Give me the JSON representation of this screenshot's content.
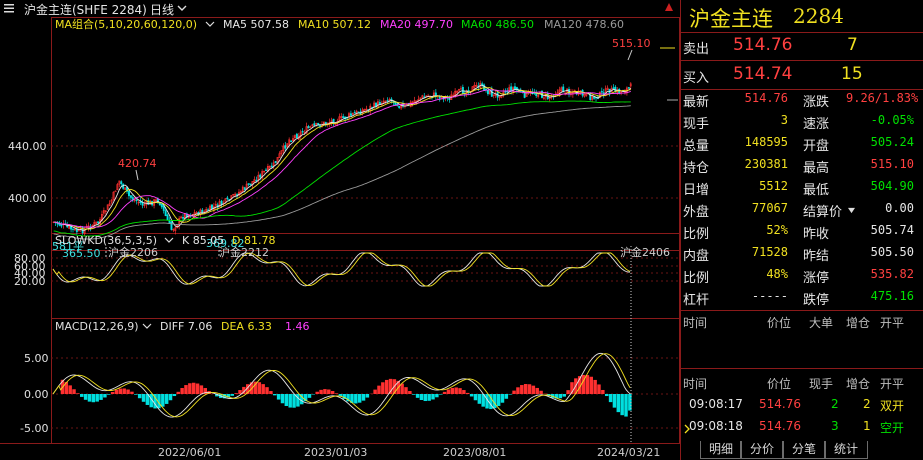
{
  "topbar": {
    "symbol_label": "沪金主连(SHFE 2284)",
    "period": "日线",
    "period_chevron": "chevron-down-icon",
    "scroll_up_icon": "triangle-up-icon"
  },
  "main_chart": {
    "indicator_title": "MA组合(5,10,20,60,120,0)",
    "ma": [
      {
        "label": "MA5 507.58",
        "color": "#e6e6e6"
      },
      {
        "label": "MA10 507.12",
        "color": "#f0e020"
      },
      {
        "label": "MA20 497.70",
        "color": "#ff40ff"
      },
      {
        "label": "MA60 486.50",
        "color": "#00e000"
      },
      {
        "label": "MA120 478.60",
        "color": "#9a9a9a"
      }
    ],
    "yticks": [
      "440.00",
      "400.00"
    ],
    "annotations": {
      "high_recent": "515.10",
      "peak_2022": "420.74",
      "low_2022": "369.82",
      "left_low": "365.50",
      "left_cut": "581平"
    },
    "contracts": [
      "沪金2206",
      "沪金2212",
      "沪金2406"
    ]
  },
  "kd_chart": {
    "title": "SLOWKD(36,5,3,5)",
    "k": "K 85.05",
    "d": "D 81.78",
    "yticks": [
      "80.00",
      "60.00",
      "40.00",
      "20.00"
    ]
  },
  "macd_chart": {
    "title": "MACD(12,26,9)",
    "diff": "DIFF 7.06",
    "dea": "DEA 6.33",
    "macd": "1.46",
    "yticks": [
      "5.00",
      "0.00",
      "-5.00"
    ]
  },
  "xaxis": [
    "2022/06/01",
    "2023/01/03",
    "2023/08/01",
    "2024/03/21"
  ],
  "quote": {
    "title": "沪金主连",
    "code": "2284",
    "sell_label": "卖出",
    "sell_price": "514.76",
    "sell_vol": "7",
    "buy_label": "买入",
    "buy_price": "514.74",
    "buy_vol": "15",
    "rows": [
      {
        "l1": "最新",
        "v1": "514.76",
        "c1": "red",
        "l2": "涨跌",
        "v2": "9.26/1.83%",
        "c2": "red"
      },
      {
        "l1": "现手",
        "v1": "3",
        "c1": "yel",
        "l2": "速涨",
        "v2": "-0.05%",
        "c2": "grn"
      },
      {
        "l1": "总量",
        "v1": "148595",
        "c1": "yel",
        "l2": "开盘",
        "v2": "505.24",
        "c2": "grn"
      },
      {
        "l1": "持仓",
        "v1": "230381",
        "c1": "yel",
        "l2": "最高",
        "v2": "515.10",
        "c2": "red"
      },
      {
        "l1": "日增",
        "v1": "5512",
        "c1": "yel",
        "l2": "最低",
        "v2": "504.90",
        "c2": "grn"
      },
      {
        "l1": "外盘",
        "v1": "77067",
        "c1": "yel",
        "l2": "结算价",
        "v2": "0.00",
        "c2": "wht"
      },
      {
        "l1": "比例",
        "v1": "52%",
        "c1": "yel",
        "l2": "昨收",
        "v2": "505.74",
        "c2": "wht"
      },
      {
        "l1": "内盘",
        "v1": "71528",
        "c1": "yel",
        "l2": "昨结",
        "v2": "505.50",
        "c2": "wht"
      },
      {
        "l1": "比例",
        "v1": "48%",
        "c1": "yel",
        "l2": "涨停",
        "v2": "535.82",
        "c2": "red"
      },
      {
        "l1": "杠杆",
        "v1": "-----",
        "c1": "wht",
        "l2": "跌停",
        "v2": "475.16",
        "c2": "grn"
      }
    ],
    "settle_chevron": "chevron-down-icon"
  },
  "bigorder": {
    "headers": [
      "时间",
      "价位",
      "大单",
      "增仓",
      "开平"
    ]
  },
  "ticks": {
    "headers": [
      "时间",
      "价位",
      "现手",
      "增仓",
      "开平"
    ],
    "rows": [
      {
        "time": "09:08:17",
        "price": "514.76",
        "vol": "2",
        "inc": "2",
        "type": "双开",
        "vol_c": "grn",
        "inc_c": "yel",
        "type_c": "yel"
      },
      {
        "time": "09:08:18",
        "price": "514.76",
        "vol": "3",
        "inc": "1",
        "type": "空开",
        "vol_c": "grn",
        "inc_c": "yel",
        "type_c": "grn"
      }
    ]
  },
  "tabs": [
    "明细",
    "分价",
    "分笔",
    "统计"
  ],
  "colors": {
    "up": "#ff3030",
    "down": "#00e0e0",
    "grid": "#8a1a1a",
    "bg": "#000000"
  }
}
